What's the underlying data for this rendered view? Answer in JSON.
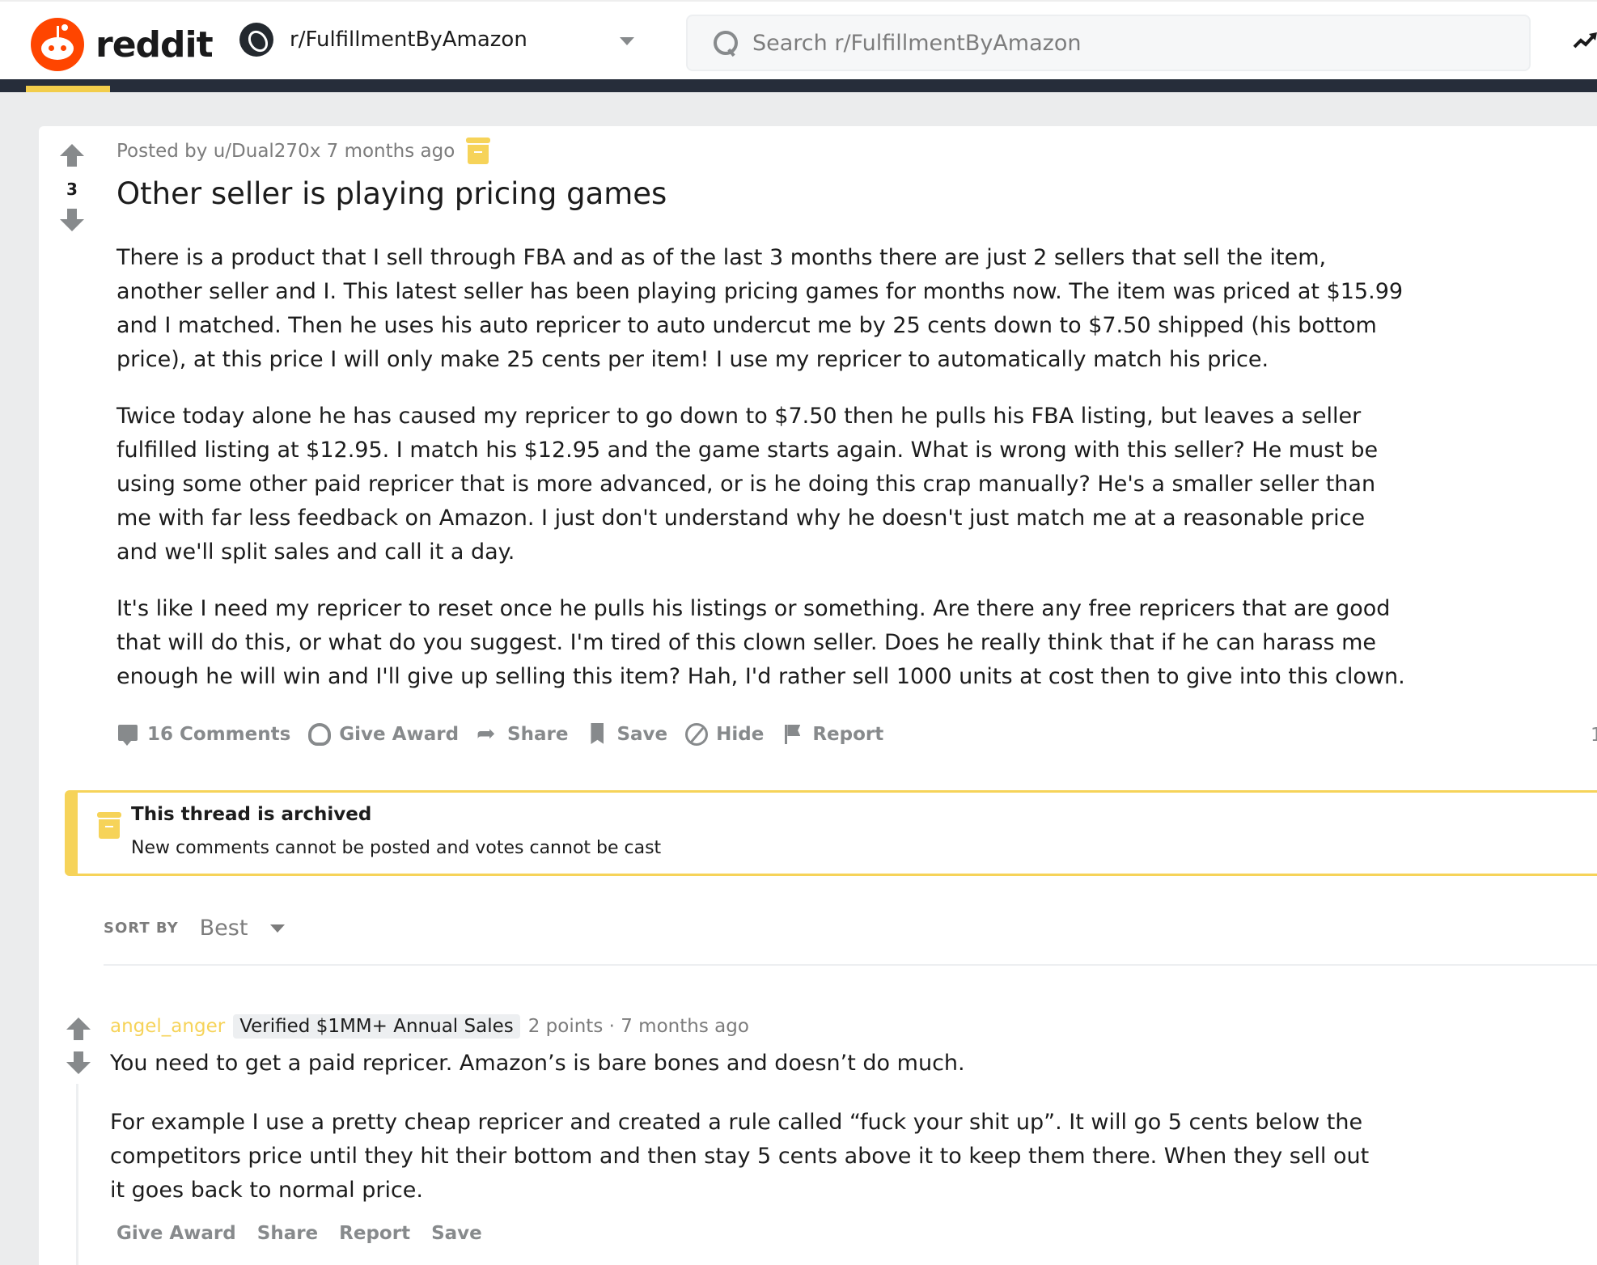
{
  "header": {
    "logo_text": "reddit",
    "subreddit": "r/FulfillmentByAmazon",
    "search_placeholder": "Search r/FulfillmentByAmazon"
  },
  "colors": {
    "brand": "#ff4500",
    "archive": "#f6d359",
    "nav_dark": "#262d3a"
  },
  "post": {
    "votes": "3",
    "meta": "Posted by u/Dual270x 7 months ago",
    "title": "Other seller is playing pricing games",
    "paragraphs": [
      "There is a product that I sell through FBA and as of the last 3 months there are just 2 sellers that sell the item, another seller and I. This latest seller has been playing pricing games for months now. The item was priced at $15.99 and I matched. Then he uses his auto repricer to auto undercut me by 25 cents down to $7.50 shipped (his bottom price), at this price I will only make 25 cents per item! I use my repricer to automatically match his price.",
      "Twice today alone he has caused my repricer to go down to $7.50 then he pulls his FBA listing, but leaves a seller fulfilled listing at $12.95. I match his $12.95 and the game starts again. What is wrong with this seller? He must be using some other paid repricer that is more advanced, or is he doing this crap manually? He's a smaller seller than me with far less feedback on Amazon. I just don't understand why he doesn't just match me at a reasonable price and we'll split sales and call it a day.",
      "It's like I need my repricer to reset once he pulls his listings or something. Are there any free repricers that are good that will do this, or what do you suggest. I'm tired of this clown seller. Does he really think that if he can harass me enough he will win and I'll give up selling this item? Hah, I'd rather sell 1000 units at cost then to give into this clown."
    ],
    "actions": {
      "comments": "16 Comments",
      "award": "Give Award",
      "share": "Share",
      "save": "Save",
      "hide": "Hide",
      "report": "Report"
    },
    "upvote_ratio_partial": "1"
  },
  "archived": {
    "title": "This thread is archived",
    "subtitle": "New comments cannot be posted and votes cannot be cast"
  },
  "sort": {
    "label": "SORT BY",
    "value": "Best"
  },
  "comment": {
    "author": "angel_anger",
    "flair": "Verified $1MM+ Annual Sales",
    "points": "2 points · 7 months ago",
    "paragraphs": [
      "You need to get a paid repricer. Amazon’s is bare bones and doesn’t do much.",
      "For example I use a pretty cheap repricer and created a rule called “fuck your shit up”. It will go 5 cents below the competitors price until they hit their bottom and then stay 5 cents above it to keep them there. When they sell out it goes back to normal price."
    ],
    "actions": [
      "Give Award",
      "Share",
      "Report",
      "Save"
    ]
  }
}
